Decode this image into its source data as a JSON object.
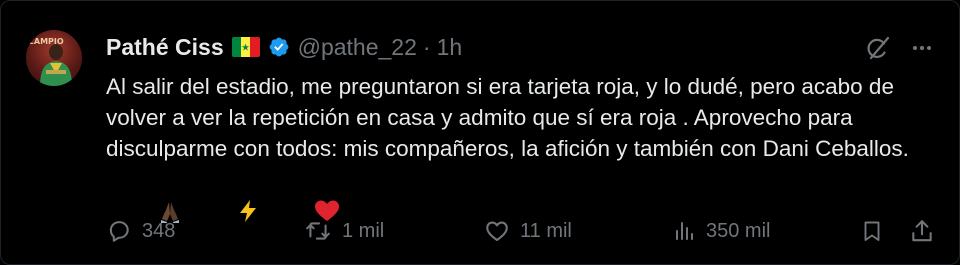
{
  "author": {
    "name": "Pathé Ciss",
    "handle": "@pathe_22",
    "separator": "·",
    "time": "1h",
    "flag_colors": [
      "#00853f",
      "#fdef42",
      "#e31b23"
    ],
    "verified_color": "#1d9bf0",
    "avatar_text": "CAMPIO"
  },
  "tweet": {
    "text": "Al salir del estadio, me preguntaron si era tarjeta roja, y lo dudé, pero acabo de volver a ver la repetición en casa y admito que sí era roja . Aprovecho para disculparme con todos: mis compañeros, la afición y también con Dani Ceballos.",
    "emojis": [
      "folded-hands-icon",
      "lightning-icon",
      "red-heart-icon"
    ]
  },
  "header_icons": [
    "grok-icon",
    "more-icon"
  ],
  "actions": {
    "replies": "348",
    "reposts": "1 mil",
    "likes": "11 mil",
    "views": "350 mil",
    "bookmark_icon": "bookmark-icon",
    "share_icon": "share-icon"
  },
  "colors": {
    "background": "#000000",
    "text": "#e7e9ea",
    "secondary": "#71767b"
  }
}
